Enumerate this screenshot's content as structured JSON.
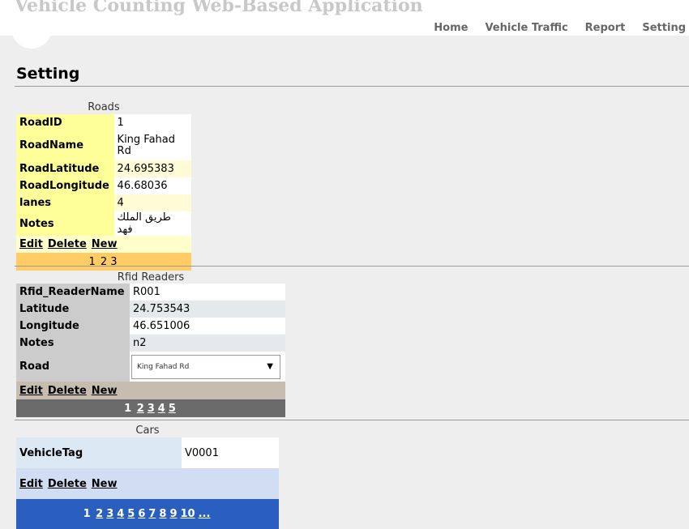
{
  "app": {
    "title": "Vehicle Counting Web-Based Application",
    "nav": [
      "Home",
      "Vehicle Traffic",
      "Report",
      "Setting"
    ]
  },
  "page": {
    "title": "Setting"
  },
  "roads": {
    "caption": "Roads",
    "fields": [
      {
        "label": "RoadID",
        "value": "1"
      },
      {
        "label": "RoadName",
        "value": "King Fahad Rd"
      },
      {
        "label": "RoadLatitude",
        "value": "24.695383"
      },
      {
        "label": "RoadLongitude",
        "value": "46.68036"
      },
      {
        "label": "lanes",
        "value": "4"
      },
      {
        "label": "Notes",
        "value": "طريق الملك فهد"
      }
    ],
    "actions": [
      "Edit",
      "Delete",
      "New"
    ],
    "pager": {
      "current": "1",
      "pages": [
        "2",
        "3"
      ]
    }
  },
  "rfid": {
    "caption": "Rfid Readers",
    "fields": [
      {
        "label": "Rfid_ReaderName",
        "value": "R001"
      },
      {
        "label": "Latitude",
        "value": "24.753543"
      },
      {
        "label": "Longitude",
        "value": "46.651006"
      },
      {
        "label": "Notes",
        "value": "n2"
      }
    ],
    "road_label": "Road",
    "road_selected": "King Fahad Rd",
    "actions": [
      "Edit",
      "Delete",
      "New"
    ],
    "pager": {
      "current": "1",
      "pages": [
        "2",
        "3",
        "4",
        "5"
      ]
    }
  },
  "cars": {
    "caption": "Cars",
    "fields": [
      {
        "label": "VehicleTag",
        "value": "V0001"
      }
    ],
    "actions": [
      "Edit",
      "Delete",
      "New"
    ],
    "pager": {
      "current": "1",
      "pages": [
        "2",
        "3",
        "4",
        "5",
        "6",
        "7",
        "8",
        "9",
        "10",
        "..."
      ]
    }
  }
}
